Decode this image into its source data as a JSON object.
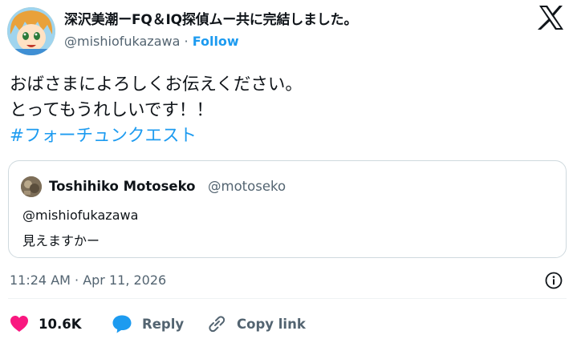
{
  "author": {
    "display_name": "深沢美潮ーFQ＆IQ探偵ムー共に完結しました。",
    "handle": "@mishiofukazawa",
    "separator": "·",
    "follow_label": "Follow"
  },
  "tweet": {
    "line1": "おばさまによろしくお伝えください。",
    "line2": "とってもうれしいです！！",
    "hashtag": "#フォーチュンクエスト"
  },
  "quoted": {
    "display_name": "Toshihiko Motoseko",
    "handle": "@motoseko",
    "line1": "@mishiofukazawa",
    "line2": "見えますかー"
  },
  "timestamp": "11:24 AM · Apr 11, 2026",
  "actions": {
    "likes": "10.6K",
    "reply_label": "Reply",
    "copy_label": "Copy link"
  },
  "colors": {
    "link": "#1d9bf0",
    "like": "#f91880",
    "secondary_text": "#536471",
    "border": "#cfd9de"
  },
  "icons": [
    "x-logo-icon",
    "info-icon",
    "heart-icon",
    "reply-bubble-icon",
    "link-icon"
  ]
}
